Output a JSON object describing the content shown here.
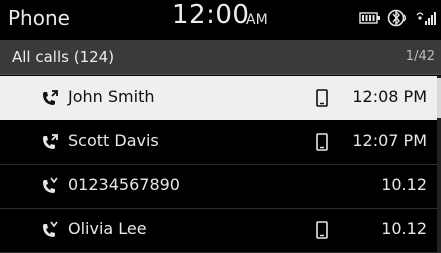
{
  "status_bar": {
    "app_title": "Phone",
    "clock": "12:00",
    "clock_ampm": "AM",
    "icons": [
      "battery-icon",
      "bluetooth-phone-icon",
      "signal-icon"
    ]
  },
  "list": {
    "title": "All calls (124)",
    "page": "1/42",
    "rows": [
      {
        "name": "John Smith",
        "time": "12:08 PM",
        "call_icon": "outgoing-call-icon",
        "device_icon": "phone-device-icon",
        "selected": true
      },
      {
        "name": "Scott Davis",
        "time": "12:07 PM",
        "call_icon": "outgoing-call-icon",
        "device_icon": "phone-device-icon",
        "selected": false
      },
      {
        "name": "01234567890",
        "time": "10.12",
        "call_icon": "missed-call-icon",
        "device_icon": "",
        "selected": false
      },
      {
        "name": "Olivia Lee",
        "time": "10.12",
        "call_icon": "missed-call-icon",
        "device_icon": "phone-device-icon",
        "selected": false
      }
    ]
  },
  "colors": {
    "background": "#000000",
    "header_bg": "#3a3a3a",
    "selected_bg": "#efefef"
  }
}
